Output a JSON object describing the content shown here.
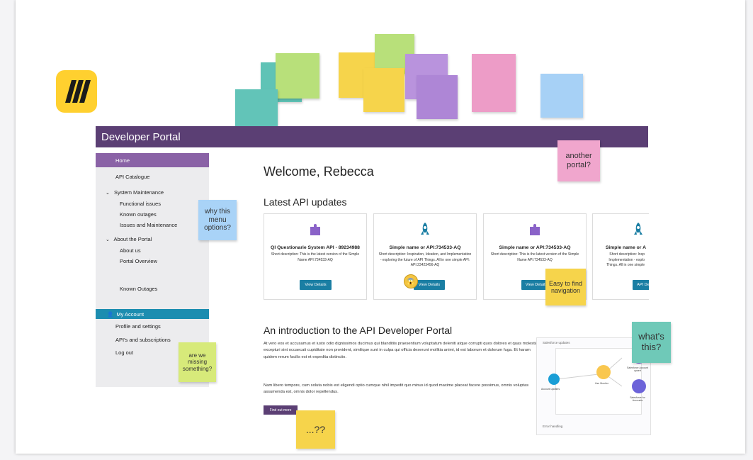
{
  "header": {
    "title": "Developer Portal"
  },
  "sidebar": {
    "home": "Home",
    "api_catalogue": "API Catalogue",
    "system_maintenance": "System Maintenance",
    "functional_issues": "Functional issues",
    "known_outages": "Known outages",
    "issues_maintenance": "Issues and Maintenance",
    "about_portal": "About the Portal",
    "about_us": "About us",
    "portal_overview": "Portal Overview",
    "known_outages_2": "Known Outages",
    "my_account": "My Account",
    "profile_settings": "Profile and settings",
    "apis_subscriptions": "API's and subscriptions",
    "log_out": "Log out"
  },
  "main": {
    "welcome": "Welcome, Rebecca",
    "latest_updates": "Latest API updates",
    "cards": [
      {
        "title": "QI Questionarie System API - 89234988",
        "desc": "Short description: This is the latest version of the Simple Name API:734533-AQ",
        "button": "View Details"
      },
      {
        "title": "Simple name or API:734533-AQ",
        "desc": "Short description: Inspiration, Ideation, and Implementation - exploring the future of API Things. All in one simple API: API:23423456-AQ",
        "button": "View Details"
      },
      {
        "title": "Simple name or API:734533-AQ",
        "desc": "Short description: This is the latest version of the Simple Name API:734533-AQ",
        "button": "View Details"
      },
      {
        "title": "Simple name or A",
        "desc": "Short description: Insp Implementation - explo Things. All in one simple",
        "button": "API De"
      }
    ],
    "intro_title": "An introduction to the API Developer Portal",
    "intro_p1": "At vero eos et accusamus et iusto odio dignissimos ducimus qui blanditiis praesentium voluptatum deleniti atque corrupti quos dolores et quas molestias excepturi sint occaecati cupiditate non provident, similique sunt in culpa qui officia deserunt mollitia animi, id est laborum et dolorum fuga. Et harum quidem rerum facilis est et expedita distinctio.",
    "intro_p2": "Nam libero tempore, cum soluta nobis est eligendi optio cumque nihil impedit quo minus id quod maxime placeat facere possimus, omnis voluptas assumenda est, omnis dolor repellendus.",
    "find_out_more": "Find out more"
  },
  "diagram": {
    "label_top": "Salesforce updates",
    "label_bottom": "Error handling",
    "node_a": "Account updates",
    "node_b": "Use Monitor",
    "node_c": "Salesforce Account upsert",
    "node_d": "Salesforce for Accounts"
  },
  "stickies": {
    "another_portal": "another portal?",
    "why_menu": "why this menu options?",
    "easy_nav": "Easy to find navigation",
    "whats_this": "what's this?",
    "missing": "are we missing something?",
    "question": "...??"
  },
  "colors": {
    "header": "#5b3f74",
    "active": "#8a62a6",
    "account": "#1c8db0",
    "button": "#1a7ea3",
    "logo": "#ffd02f"
  }
}
